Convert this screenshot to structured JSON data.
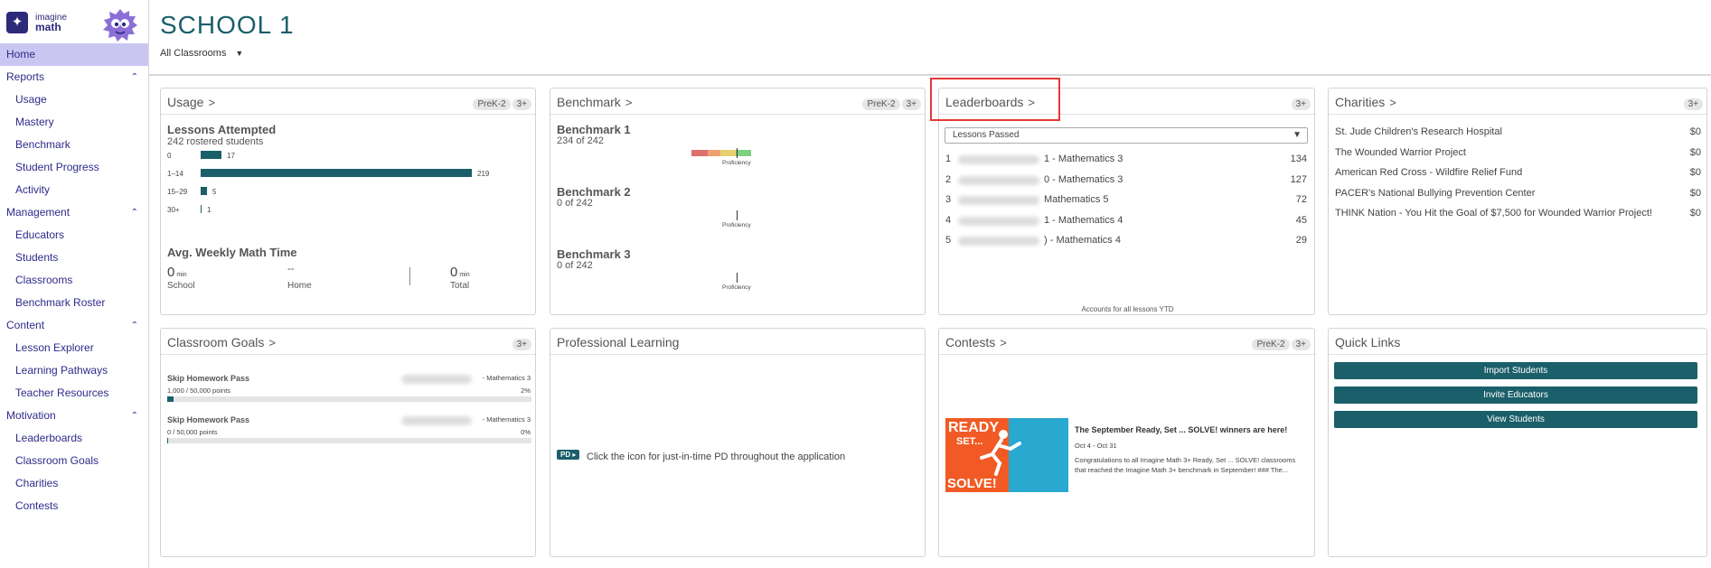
{
  "brand": {
    "line1": "imagine",
    "line2": "math"
  },
  "sidebar": {
    "items": [
      {
        "label": "Home",
        "kind": "active"
      },
      {
        "label": "Reports",
        "kind": "section"
      },
      {
        "label": "Usage",
        "kind": "sub"
      },
      {
        "label": "Mastery",
        "kind": "sub"
      },
      {
        "label": "Benchmark",
        "kind": "sub"
      },
      {
        "label": "Student Progress",
        "kind": "sub"
      },
      {
        "label": "Activity",
        "kind": "sub"
      },
      {
        "label": "Management",
        "kind": "section"
      },
      {
        "label": "Educators",
        "kind": "sub"
      },
      {
        "label": "Students",
        "kind": "sub"
      },
      {
        "label": "Classrooms",
        "kind": "sub"
      },
      {
        "label": "Benchmark Roster",
        "kind": "sub"
      },
      {
        "label": "Content",
        "kind": "section"
      },
      {
        "label": "Lesson Explorer",
        "kind": "sub"
      },
      {
        "label": "Learning Pathways",
        "kind": "sub"
      },
      {
        "label": "Teacher Resources",
        "kind": "sub"
      },
      {
        "label": "Motivation",
        "kind": "section"
      },
      {
        "label": "Leaderboards",
        "kind": "sub"
      },
      {
        "label": "Classroom Goals",
        "kind": "sub"
      },
      {
        "label": "Charities",
        "kind": "sub"
      },
      {
        "label": "Contests",
        "kind": "sub"
      }
    ]
  },
  "header": {
    "title": "SCHOOL 1",
    "classroom_select": "All Classrooms"
  },
  "usage": {
    "title": "Usage",
    "badges": [
      "PreK-2",
      "3+"
    ],
    "heading": "Lessons Attempted",
    "subheading": "242 rostered students",
    "rows": [
      {
        "label": "0",
        "value": "17",
        "count": 17
      },
      {
        "label": "1–14",
        "value": "219",
        "count": 219
      },
      {
        "label": "15–29",
        "value": "5",
        "count": 5
      },
      {
        "label": "30+",
        "value": "1",
        "count": 1
      }
    ],
    "weekly_heading": "Avg. Weekly Math Time",
    "school_value": "0",
    "school_unit": "min",
    "school_label": "School",
    "home_value": "--",
    "home_label": "Home",
    "total_value": "0",
    "total_unit": "min",
    "total_label": "Total"
  },
  "benchmark": {
    "title": "Benchmark",
    "badges": [
      "PreK-2",
      "3+"
    ],
    "items": [
      {
        "name": "Benchmark 1",
        "count": "234 of 242",
        "proficiency_label": "Proficiency"
      },
      {
        "name": "Benchmark 2",
        "count": "0 of 242",
        "proficiency_label": "Proficiency"
      },
      {
        "name": "Benchmark 3",
        "count": "0 of 242",
        "proficiency_label": "Proficiency"
      }
    ]
  },
  "leaderboards": {
    "title": "Leaderboards",
    "badges": [
      "3+"
    ],
    "select": "Lessons Passed",
    "rows": [
      {
        "rank": "1",
        "class_suffix": "1 - Mathematics 3",
        "value": "134"
      },
      {
        "rank": "2",
        "class_suffix": "0 - Mathematics 3",
        "value": "127"
      },
      {
        "rank": "3",
        "class_suffix": "Mathematics 5",
        "value": "72"
      },
      {
        "rank": "4",
        "class_suffix": "1 - Mathematics 4",
        "value": "45"
      },
      {
        "rank": "5",
        "class_suffix": ") - Mathematics 4",
        "value": "29"
      }
    ],
    "footnote": "Accounts for all lessons YTD"
  },
  "charities": {
    "title": "Charities",
    "badges": [
      "3+"
    ],
    "rows": [
      {
        "name": "St. Jude Children's Research Hospital",
        "amount": "$0"
      },
      {
        "name": "The Wounded Warrior Project",
        "amount": "$0"
      },
      {
        "name": "American Red Cross - Wildfire Relief Fund",
        "amount": "$0"
      },
      {
        "name": "PACER's National Bullying Prevention Center",
        "amount": "$0"
      },
      {
        "name": "THINK Nation - You Hit the Goal of $7,500 for Wounded Warrior Project!",
        "amount": "$0"
      }
    ]
  },
  "goals": {
    "title": "Classroom Goals",
    "badges": [
      "3+"
    ],
    "items": [
      {
        "name": "Skip Homework Pass",
        "class": "- Mathematics 3",
        "points": "1,000 / 50,000 points",
        "pct": "2%",
        "progress": 0.02
      },
      {
        "name": "Skip Homework Pass",
        "class": "- Mathematics 3",
        "points": "0 / 50,000 points",
        "pct": "0%",
        "progress": 0
      }
    ]
  },
  "pl": {
    "title": "Professional Learning",
    "pd_badge": "PD ▸",
    "text": "Click the icon for just-in-time PD throughout the application"
  },
  "contests": {
    "title": "Contests",
    "badges": [
      "PreK-2",
      "3+"
    ],
    "image_text": {
      "ready": "READY",
      "set": "SET...",
      "solve": "SOLVE!"
    },
    "headline": "The September Ready, Set ... SOLVE! winners are here!",
    "dates": "Oct 4 - Oct 31",
    "body": "Congratulations to all Imagine Math 3+ Ready, Set ... SOLVE! classrooms that reached the Imagine Math 3+ benchmark in September! ### The..."
  },
  "quick_links": {
    "title": "Quick Links",
    "buttons": [
      "Import Students",
      "Invite Educators",
      "View Students"
    ]
  },
  "colors": {
    "teal": "#1a5f6a",
    "nav": "#2e2a8a",
    "active_nav": "#c9c7f1",
    "highlight": "#e53935"
  }
}
